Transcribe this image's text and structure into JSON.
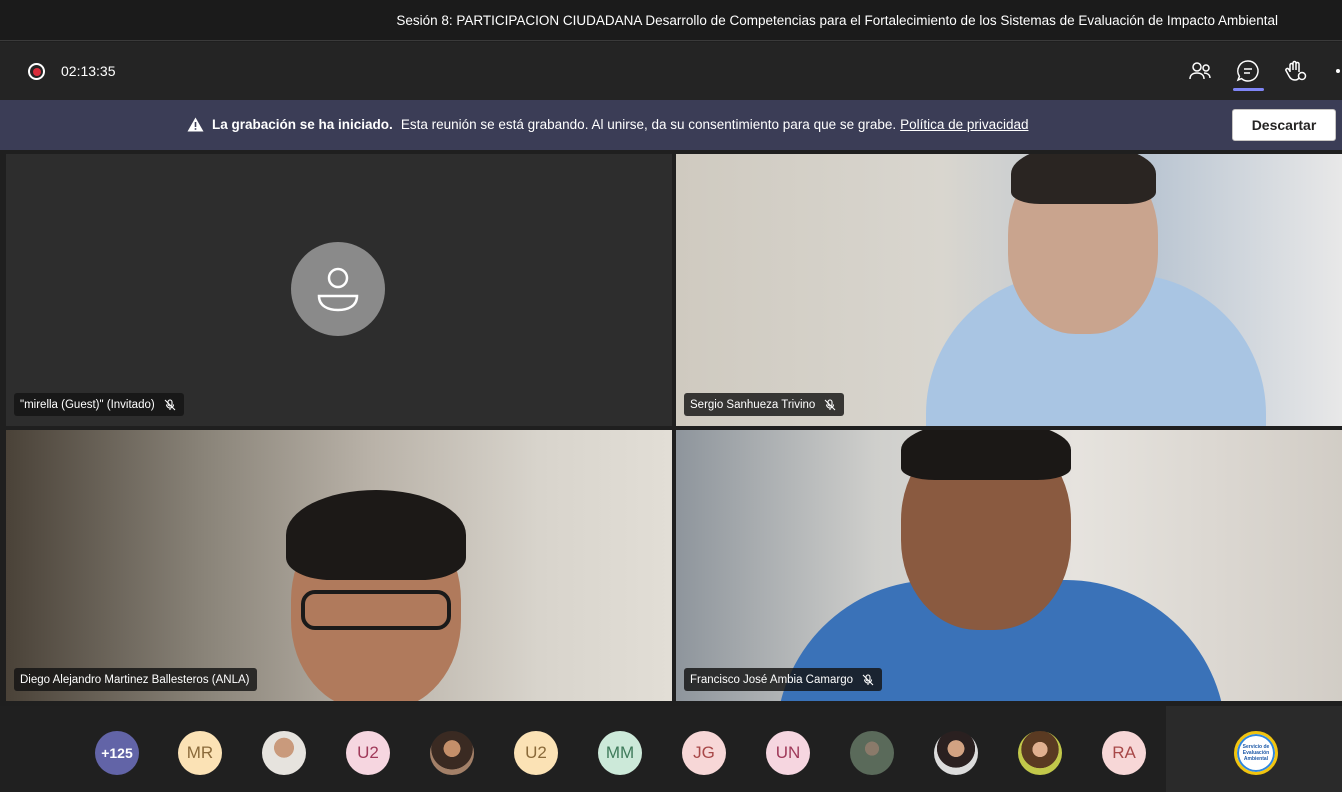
{
  "window": {
    "title": "Sesión 8: PARTICIPACION CIUDADANA Desarrollo de Competencias para el Fortalecimiento de los Sistemas de Evaluación de Impacto Ambiental"
  },
  "toolbar": {
    "timer": "02:13:35",
    "icons": [
      "people-icon",
      "chat-icon",
      "raise-hand-icon",
      "more-icon"
    ]
  },
  "banner": {
    "bold_text": "La grabación se ha iniciado.",
    "text": "Esta reunión se está grabando. Al unirse, da su consentimiento para que se grabe.",
    "link": "Política de privacidad",
    "dismiss_label": "Descartar"
  },
  "tiles": [
    {
      "name": "\"mirella (Guest)\" (Invitado)",
      "muted": true
    },
    {
      "name": "Sergio Sanhueza Trivino",
      "muted": true
    },
    {
      "name": "Diego Alejandro Martinez Ballesteros (ANLA)",
      "muted": false
    },
    {
      "name": "Francisco José Ambia Camargo",
      "muted": true
    }
  ],
  "participants": {
    "overflow_count": "+125",
    "initials": [
      "MR",
      "U2",
      "U2",
      "MM",
      "JG",
      "UN",
      "RA"
    ]
  },
  "logo": {
    "lines": [
      "Servicio de",
      "Evaluación",
      "Ambiental"
    ]
  },
  "colors": {
    "banner_bg": "#3b3d56",
    "accent": "#7f85f5",
    "record_red": "#d92c3a",
    "overflow_avatar": "#6264a7"
  }
}
